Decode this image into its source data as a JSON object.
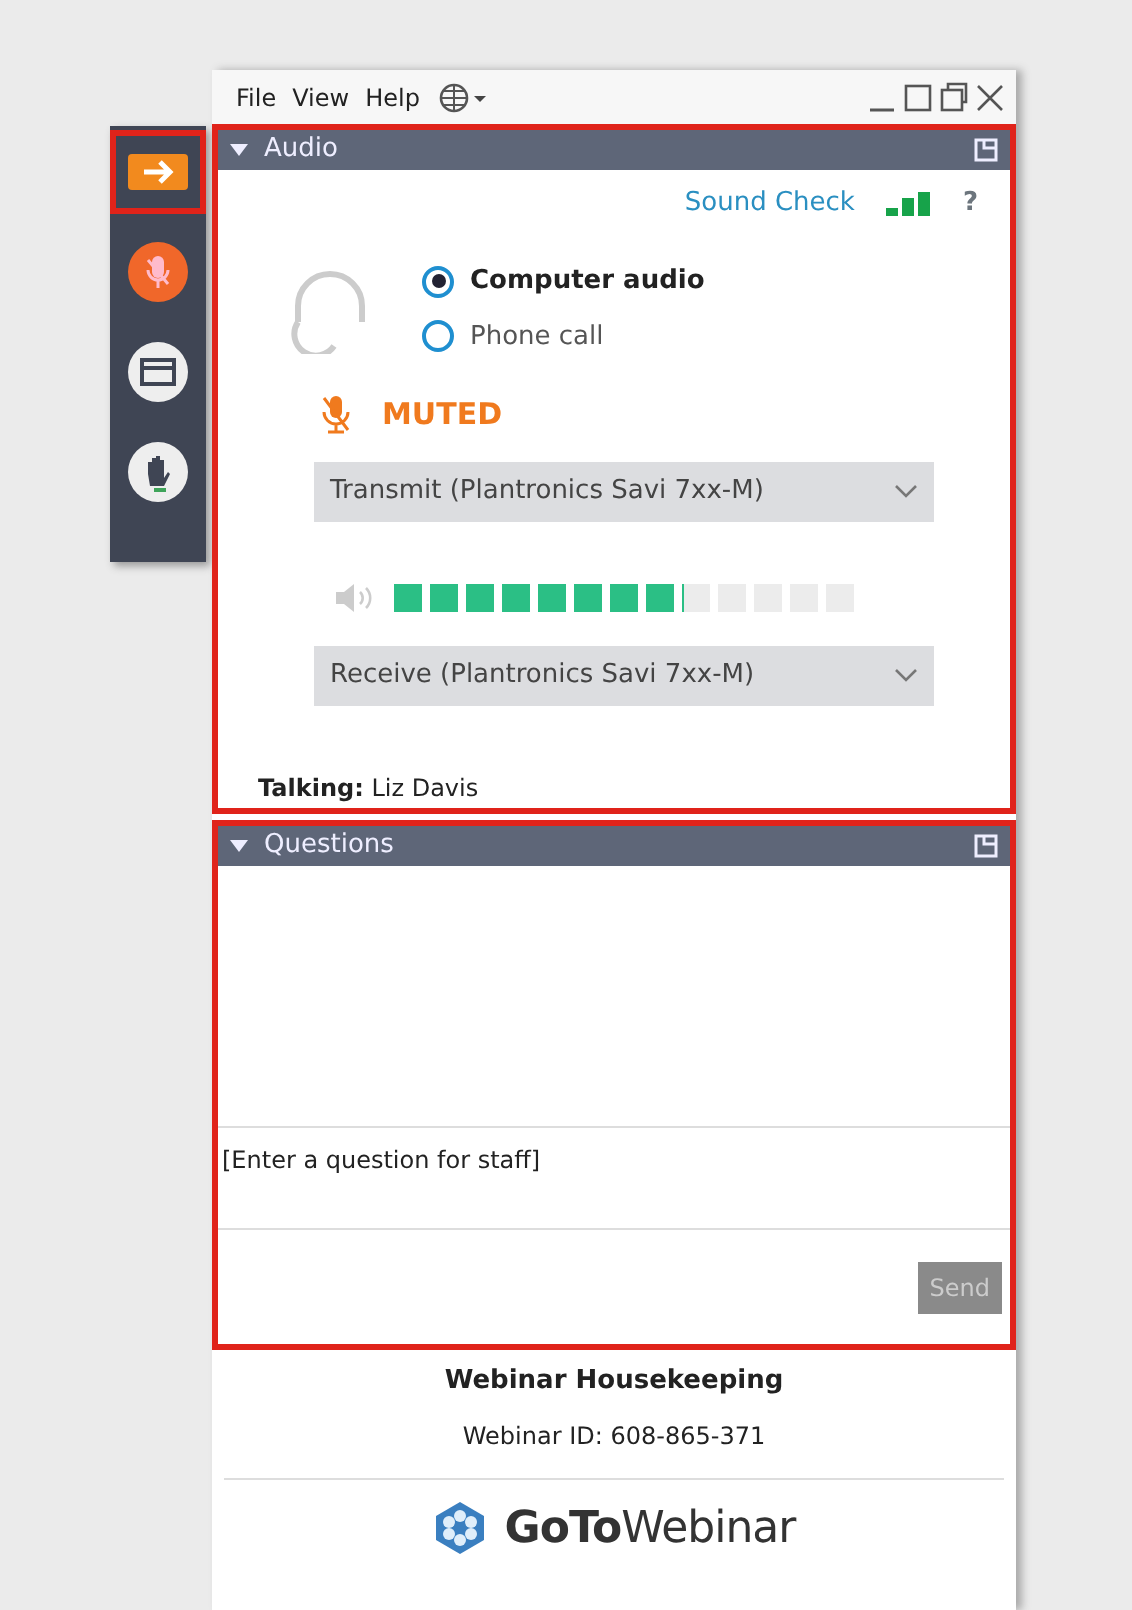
{
  "menu_bar": {
    "items": [
      "File",
      "View",
      "Help"
    ]
  },
  "side_toolbar": [
    {
      "kind": "arrow",
      "highlighted": true
    },
    {
      "kind": "mic",
      "highlighted": false
    },
    {
      "kind": "window",
      "highlighted": false
    },
    {
      "kind": "hand",
      "highlighted": false
    }
  ],
  "audio": {
    "title": "Audio",
    "expanded": true,
    "highlighted": true,
    "sound_check": "Sound Check",
    "help": "?",
    "modes": [
      {
        "label": "Computer audio",
        "selected": true
      },
      {
        "label": "Phone call",
        "selected": false
      }
    ],
    "mute_status": "MUTED",
    "transmit": "Transmit (Plantronics Savi 7xx-M)",
    "speaker": {
      "level": 0.62
    },
    "receive": "Receive (Plantronics Savi 7xx-M)",
    "talking": "**Talking:** Liz Davis"
  },
  "questions": {
    "title": "Questions",
    "expanded": true,
    "highlighted": true,
    "placeholder": "[Enter a question for staff]",
    "send": {
      "label": "Send",
      "disabled": true
    }
  },
  "footer": {
    "title": "Webinar Housekeeping",
    "webinar_id": "Webinar ID: 608-865-371",
    "logo": "**GoTo**Webinar"
  }
}
